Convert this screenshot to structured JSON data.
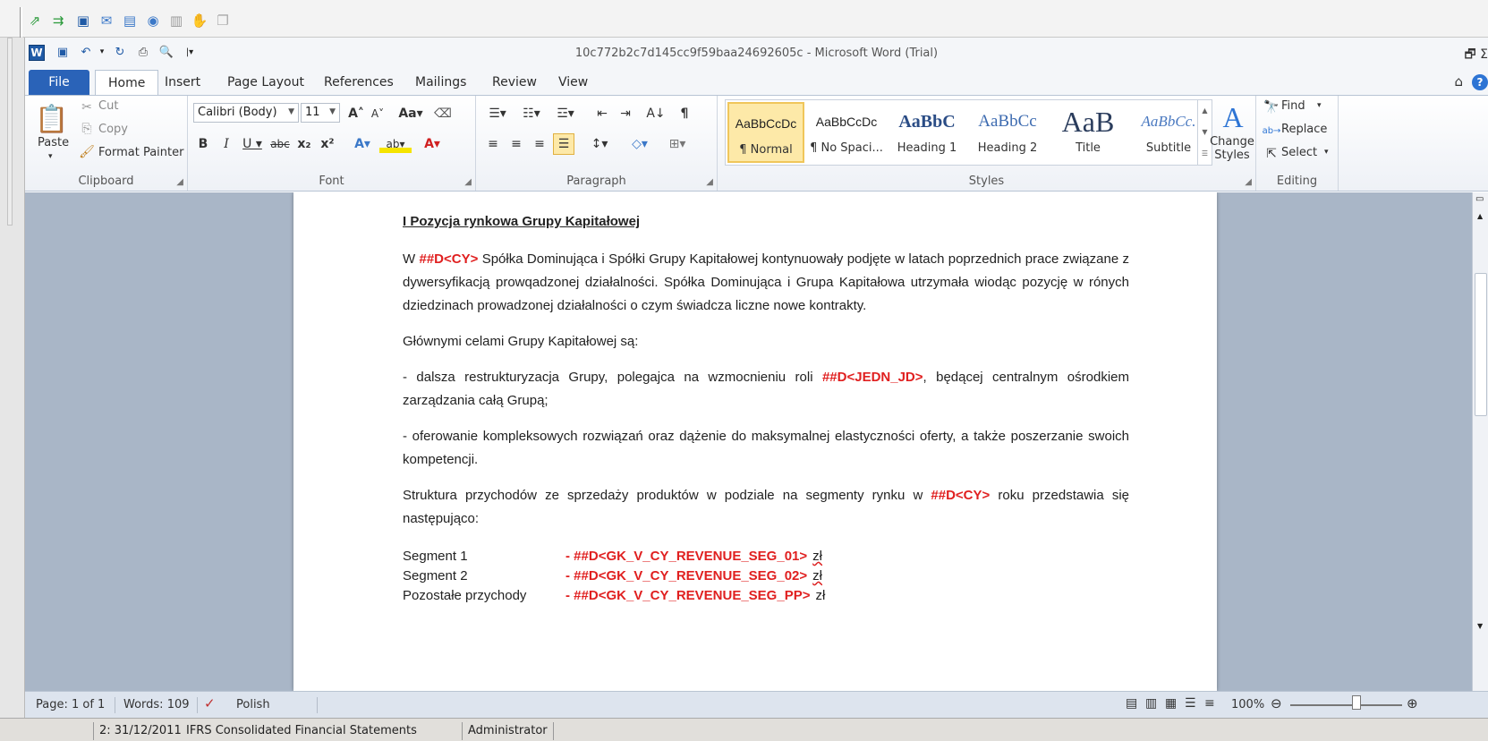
{
  "outer_toolbar": {
    "icons": [
      "green-arrow-icon",
      "green-arrows-icon",
      "save-icon",
      "mail-icon",
      "calendar-icon",
      "globe-icon",
      "book-icon",
      "hand-icon",
      "disabled-doc-icon"
    ]
  },
  "window": {
    "title": "10c772b2c7d145cc9f59baa24692605c  -  Microsoft Word (Trial)"
  },
  "tabs": {
    "file": "File",
    "home": "Home",
    "insert": "Insert",
    "page_layout": "Page Layout",
    "references": "References",
    "mailings": "Mailings",
    "review": "Review",
    "view": "View"
  },
  "clipboard": {
    "paste": "Paste",
    "cut": "Cut",
    "copy": "Copy",
    "format_painter": "Format Painter",
    "label": "Clipboard"
  },
  "font": {
    "name": "Calibri (Body)",
    "size": "11",
    "label": "Font"
  },
  "paragraph": {
    "label": "Paragraph"
  },
  "styles": {
    "items": [
      {
        "preview": "AaBbCcDc",
        "name": "¶ Normal"
      },
      {
        "preview": "AaBbCcDc",
        "name": "¶ No Spaci..."
      },
      {
        "preview": "AaBbC",
        "name": "Heading 1"
      },
      {
        "preview": "AaBbCc",
        "name": "Heading 2"
      },
      {
        "preview": "AaB",
        "name": "Title"
      },
      {
        "preview": "AaBbCc.",
        "name": "Subtitle"
      }
    ],
    "change_styles": "Change Styles",
    "label": "Styles"
  },
  "editing": {
    "find": "Find",
    "replace": "Replace",
    "select": "Select",
    "label": "Editing"
  },
  "document": {
    "heading": "I Pozycja rynkowa Grupy Kapitałowej",
    "p1": {
      "pre": "W ",
      "field": "##D<CY>",
      "post": " Spółka Dominująca i Spółki Grupy Kapitałowej kontynuowały podjęte w latach poprzednich prace związane z dywersyfikacją prowqadzonej działalności. Spółka Dominująca i Grupa Kapitałowa utrzymała wiodąc pozycję w rónych dziedzinach prowadzonej działalności o czym świadcza liczne nowe kontrakty."
    },
    "p2": "Głównymi celami Grupy Kapitałowej są:",
    "p3": {
      "pre": "- dalsza restrukturyzacja Grupy, polegajca na wzmocnieniu roli ",
      "field": "##D<JEDN_JD>",
      "post": ", będącej centralnym ośrodkiem zarządzania całą Grupą;"
    },
    "p4": "- oferowanie kompleksowych rozwiązań oraz dążenie do maksymalnej elastyczności oferty, a także poszerzanie swoich kompetencji.",
    "p5": {
      "pre": "Struktura przychodów ze sprzedaży produktów w podziale na segmenty rynku w ",
      "field": "##D<CY>",
      "post": " roku przedstawia się następująco:"
    },
    "segments": [
      {
        "name": "Segment 1",
        "dash": "- ",
        "field": "##D<GK_V_CY_REVENUE_SEG_01>",
        "unit": "zł"
      },
      {
        "name": "Segment 2",
        "dash": "- ",
        "field": "##D<GK_V_CY_REVENUE_SEG_02>",
        "unit": "zł"
      },
      {
        "name": "Pozostałe przychody",
        "dash": "- ",
        "field": "##D<GK_V_CY_REVENUE_SEG_PP>",
        "unit": "zł"
      }
    ]
  },
  "status": {
    "page": "Page: 1 of 1",
    "words": "Words: 109",
    "language": "Polish",
    "zoom": "100%",
    "zoom_level": 1.0
  },
  "app_status": {
    "period": "2: 31/12/2011",
    "report": "IFRS Consolidated Financial Statements",
    "user": "Administrator"
  }
}
